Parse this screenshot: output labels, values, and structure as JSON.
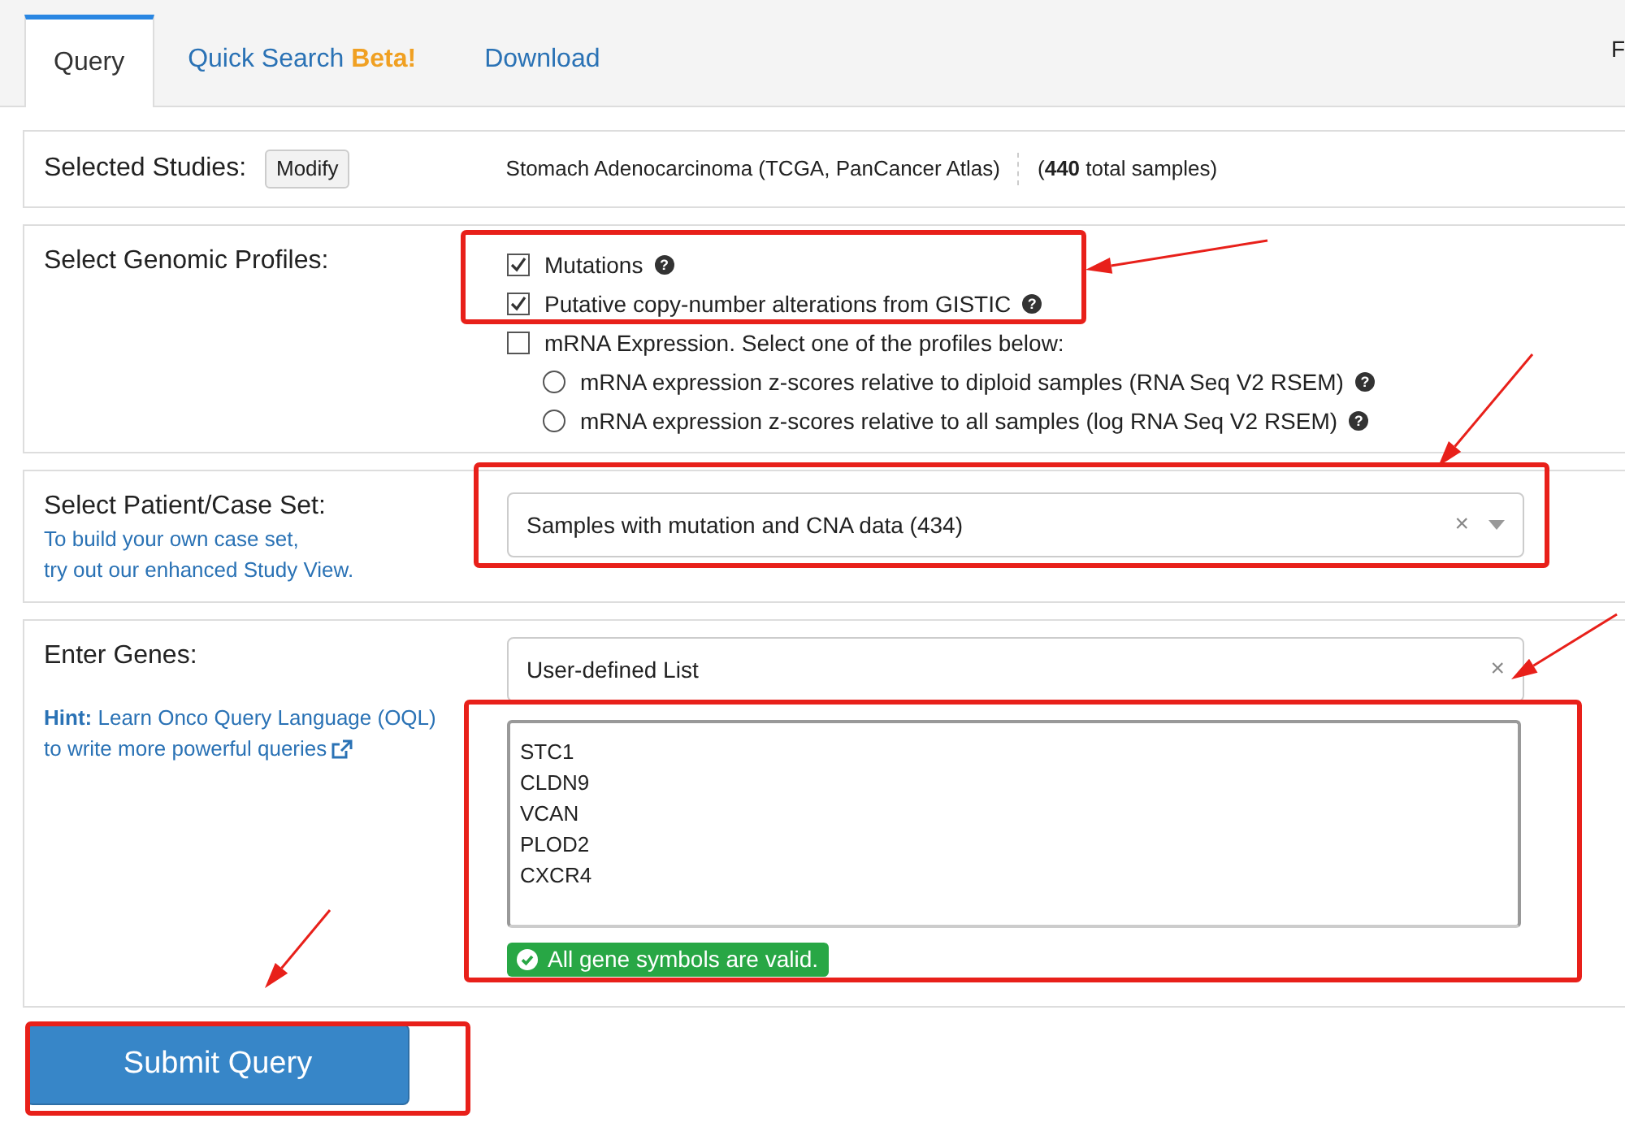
{
  "tabs": [
    {
      "label": "Query",
      "selected": true
    },
    {
      "label": "Quick Search",
      "badge": "Beta!",
      "selected": false
    },
    {
      "label": "Download",
      "selected": false
    }
  ],
  "top_right_text": "F",
  "selected_studies": {
    "label": "Selected Studies:",
    "button": "Modify",
    "study": "Stomach Adenocarcinoma (TCGA, PanCancer Atlas)",
    "total": "(**440** total samples)"
  },
  "genomic_profiles": {
    "label": "Select Genomic Profiles:",
    "options": [
      {
        "kind": "checkbox",
        "label": "Mutations",
        "checked": true,
        "help": "?"
      },
      {
        "kind": "checkbox",
        "label": "Putative copy-number alterations from GISTIC",
        "checked": true,
        "help": "?"
      },
      {
        "kind": "checkbox",
        "label": "mRNA Expression. Select one of the profiles below:",
        "checked": false,
        "children": [
          {
            "kind": "radio",
            "label": "mRNA expression z-scores relative to diploid samples (RNA Seq V2 RSEM)",
            "selected": false,
            "help": "?"
          },
          {
            "kind": "radio",
            "label": "mRNA expression z-scores relative to all samples (log RNA Seq V2 RSEM)",
            "selected": false,
            "help": "?"
          }
        ]
      }
    ]
  },
  "case_set": {
    "label": "Select Patient/Case Set:",
    "hint_lines": [
      "To build your own case set,",
      "try out our enhanced Study View."
    ],
    "value": "Samples with mutation and CNA data (434)",
    "clear": "×",
    "dropdown": true
  },
  "genes": {
    "label": "Enter Genes:",
    "hint_label": "Hint:",
    "hint_link": "Learn Onco Query Language (OQL)",
    "hint_link_2": "to write more powerful queries",
    "gene_set": "User-defined List",
    "clear": "×",
    "dropdown": false,
    "gene_list": [
      "STC1",
      "CLDN9",
      "VCAN",
      "PLOD2",
      "CXCR4"
    ],
    "validation": "All gene symbols are valid."
  },
  "submit_button": "Submit Query"
}
